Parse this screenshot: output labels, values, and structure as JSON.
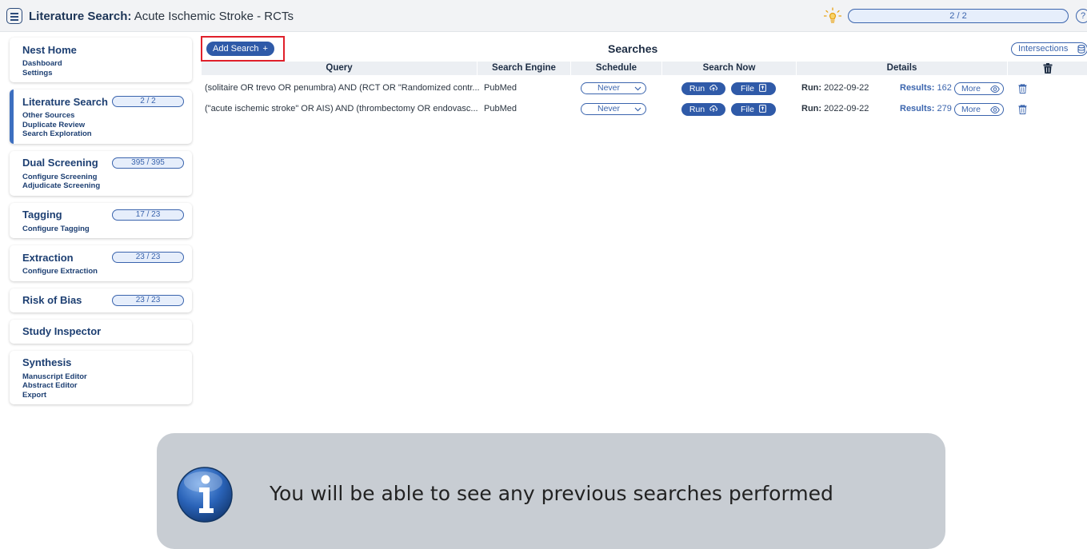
{
  "header": {
    "title_bold": "Literature Search:",
    "title_rest": "Acute Ischemic Stroke - RCTs",
    "progress": "2 / 2",
    "help": "?",
    "bulb_icon": "lightbulb-icon"
  },
  "sidebar": [
    {
      "title": "Nest Home",
      "progress": "",
      "active": false,
      "subs": [
        "Dashboard",
        "Settings"
      ]
    },
    {
      "title": "Literature Search",
      "progress": "2 / 2",
      "active": true,
      "subs": [
        "Other Sources",
        "Duplicate Review",
        "Search Exploration"
      ]
    },
    {
      "title": "Dual Screening",
      "progress": "395 / 395",
      "active": false,
      "subs": [
        "Configure Screening",
        "Adjudicate Screening"
      ]
    },
    {
      "title": "Tagging",
      "progress": "17 / 23",
      "active": false,
      "subs": [
        "Configure Tagging"
      ]
    },
    {
      "title": "Extraction",
      "progress": "23 / 23",
      "active": false,
      "subs": [
        "Configure Extraction"
      ]
    },
    {
      "title": "Risk of Bias",
      "progress": "23 / 23",
      "active": false,
      "subs": []
    },
    {
      "title": "Study Inspector",
      "progress": "",
      "active": false,
      "subs": []
    },
    {
      "title": "Synthesis",
      "progress": "",
      "active": false,
      "subs": [
        "Manuscript Editor",
        "Abstract Editor",
        "Export"
      ]
    }
  ],
  "searches": {
    "add_label": "Add Search",
    "add_plus": "+",
    "title": "Searches",
    "intersections_label": "Intersections",
    "columns": {
      "query": "Query",
      "engine": "Search Engine",
      "schedule": "Schedule",
      "search_now": "Search Now",
      "details": "Details"
    },
    "rows": [
      {
        "query": "(solitaire OR trevo OR penumbra) AND (RCT OR \"Randomized contr...",
        "engine": "PubMed",
        "schedule": "Never",
        "run_label": "Run",
        "file_label": "File",
        "run_key": "Run:",
        "run_date": "2022-09-22",
        "results_key": "Results:",
        "results_count": "162",
        "more_label": "More"
      },
      {
        "query": "(\"acute ischemic stroke\" OR AIS) AND (thrombectomy OR endovasc...",
        "engine": "PubMed",
        "schedule": "Never",
        "run_label": "Run",
        "file_label": "File",
        "run_key": "Run:",
        "run_date": "2022-09-22",
        "results_key": "Results:",
        "results_count": "279",
        "more_label": "More"
      }
    ]
  },
  "info": {
    "text": "You will be able to see any previous searches performed",
    "icon": "info-icon"
  },
  "colors": {
    "accent": "#2f5aa8",
    "highlight": "#e0202a",
    "info_bg": "#c8cdd3"
  }
}
